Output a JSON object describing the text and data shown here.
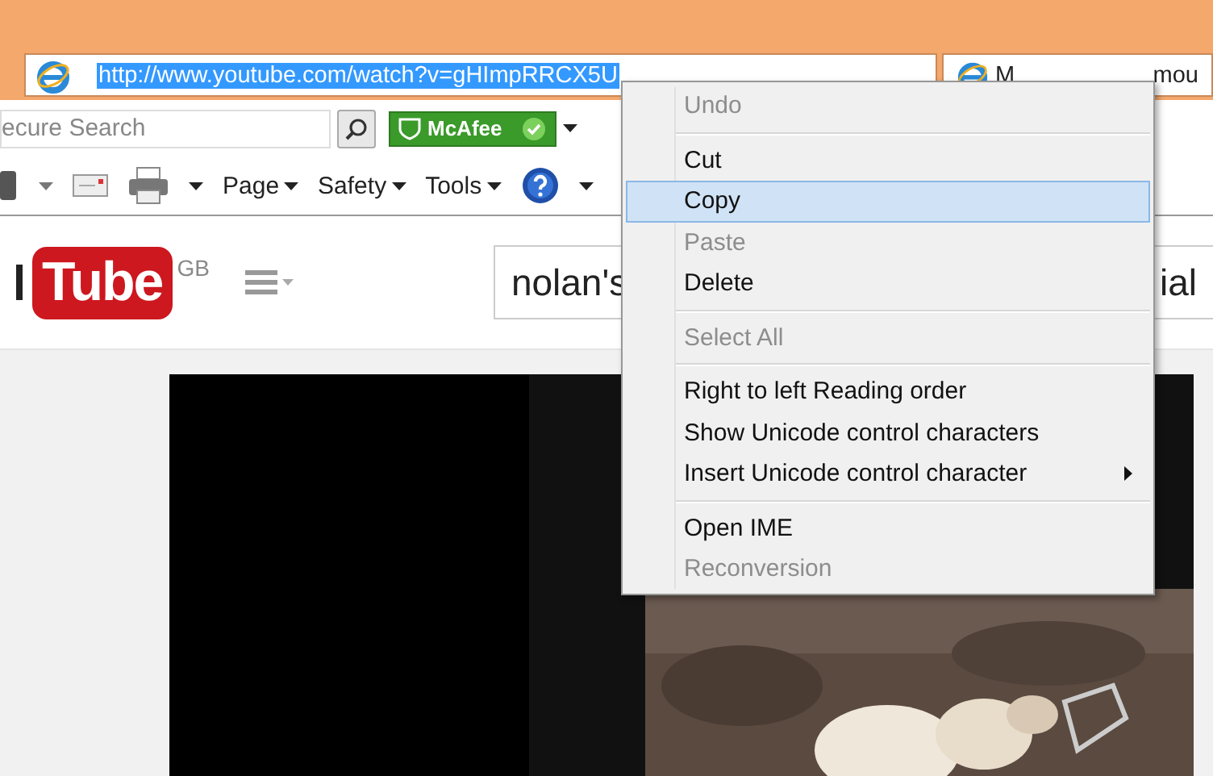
{
  "address_bar": {
    "url": "http://www.youtube.com/watch?v=gHImpRRCX5U",
    "selected": true
  },
  "tab": {
    "title_parts": [
      "M",
      "mou"
    ]
  },
  "search_box": {
    "placeholder": "ecure Search"
  },
  "mcafee_badge": {
    "label": "McAfee"
  },
  "command_bar": {
    "items": [
      {
        "kind": "print"
      },
      {
        "kind": "menu",
        "label": "Page"
      },
      {
        "kind": "menu",
        "label": "Safety"
      },
      {
        "kind": "menu",
        "label": "Tools"
      },
      {
        "kind": "help"
      }
    ]
  },
  "youtube": {
    "logo": "Tube",
    "region": "GB",
    "search_value": "nolan's",
    "search_value_tail": "ial"
  },
  "context_menu": {
    "items": [
      {
        "kind": "item",
        "label": "Undo",
        "disabled": true,
        "selected": false,
        "has_submenu": false
      },
      {
        "kind": "separator"
      },
      {
        "kind": "item",
        "label": "Cut",
        "disabled": false,
        "selected": false,
        "has_submenu": false
      },
      {
        "kind": "item",
        "label": "Copy",
        "disabled": false,
        "selected": true,
        "has_submenu": false
      },
      {
        "kind": "item",
        "label": "Paste",
        "disabled": true,
        "selected": false,
        "has_submenu": false
      },
      {
        "kind": "item",
        "label": "Delete",
        "disabled": false,
        "selected": false,
        "has_submenu": false
      },
      {
        "kind": "separator"
      },
      {
        "kind": "item",
        "label": "Select All",
        "disabled": true,
        "selected": false,
        "has_submenu": false
      },
      {
        "kind": "separator"
      },
      {
        "kind": "item",
        "label": "Right to left Reading order",
        "disabled": false,
        "selected": false,
        "has_submenu": false
      },
      {
        "kind": "item",
        "label": "Show Unicode control characters",
        "disabled": false,
        "selected": false,
        "has_submenu": false
      },
      {
        "kind": "item",
        "label": "Insert Unicode control character",
        "disabled": false,
        "selected": false,
        "has_submenu": true
      },
      {
        "kind": "separator"
      },
      {
        "kind": "item",
        "label": "Open IME",
        "disabled": false,
        "selected": false,
        "has_submenu": false
      },
      {
        "kind": "item",
        "label": "Reconversion",
        "disabled": true,
        "selected": false,
        "has_submenu": false
      }
    ]
  }
}
